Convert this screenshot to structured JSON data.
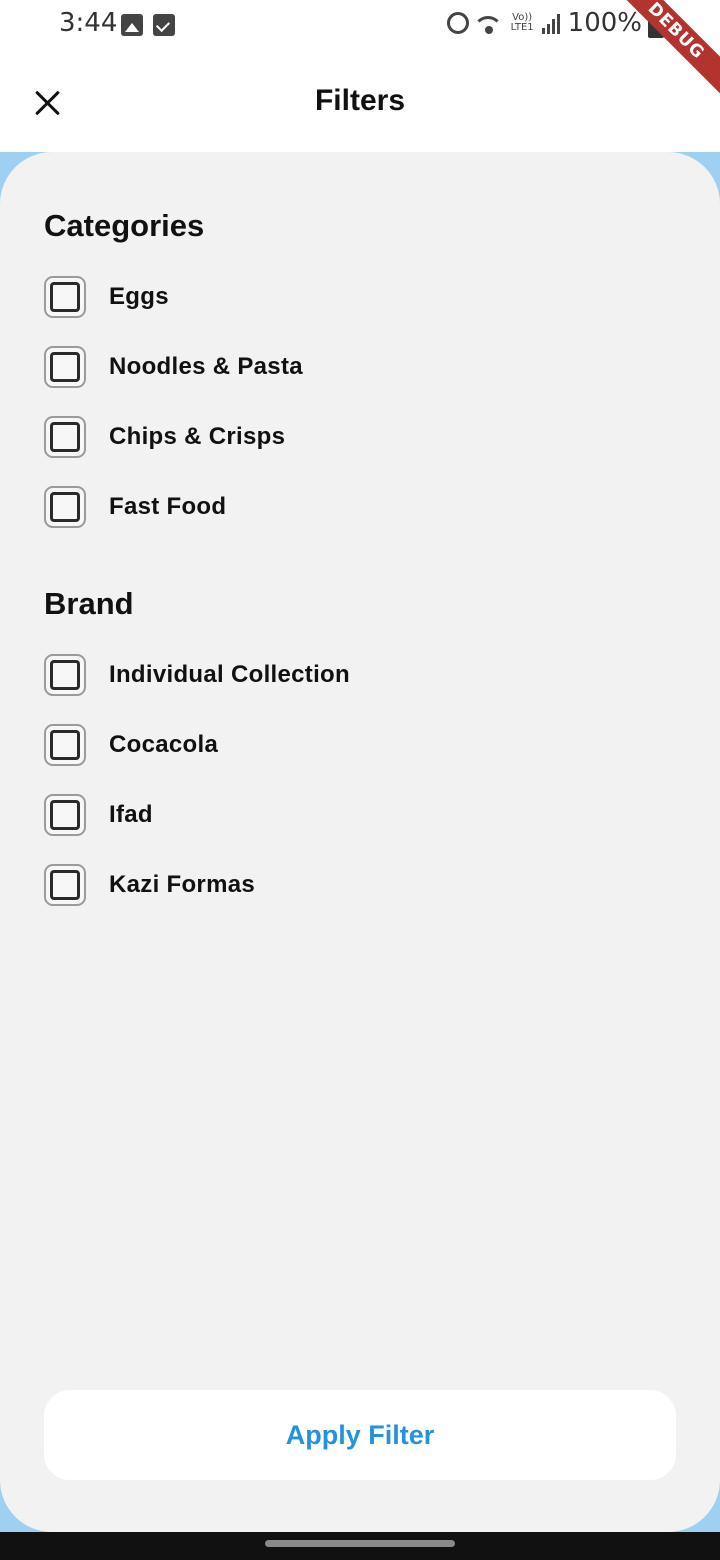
{
  "status_bar": {
    "time": "3:44",
    "left_icons": [
      "image-icon",
      "checkbox-icon"
    ],
    "right_icons": [
      "alarm-icon",
      "wifi-icon",
      "lte-icon",
      "signal-icon",
      "battery-icon"
    ],
    "lte_top": "Vo))",
    "lte_bottom": "LTE1",
    "battery": "100%"
  },
  "debug_banner": "DEBUG",
  "header": {
    "title": "Filters",
    "close_icon": "close-icon"
  },
  "categories": {
    "title": "Categories",
    "items": [
      {
        "label": "Eggs",
        "checked": false
      },
      {
        "label": "Noodles & Pasta",
        "checked": false
      },
      {
        "label": "Chips & Crisps",
        "checked": false
      },
      {
        "label": "Fast Food",
        "checked": false
      }
    ]
  },
  "brand": {
    "title": "Brand",
    "items": [
      {
        "label": "Individual Collection",
        "checked": false
      },
      {
        "label": "Cocacola",
        "checked": false
      },
      {
        "label": "Ifad",
        "checked": false
      },
      {
        "label": "Kazi Formas",
        "checked": false
      }
    ]
  },
  "apply_button": {
    "label": "Apply Filter"
  },
  "colors": {
    "accent": "#2592e0",
    "sheet_background": "#f2f2f2",
    "backdrop": "#9fd0f2",
    "debug_ribbon": "#b3332e"
  }
}
